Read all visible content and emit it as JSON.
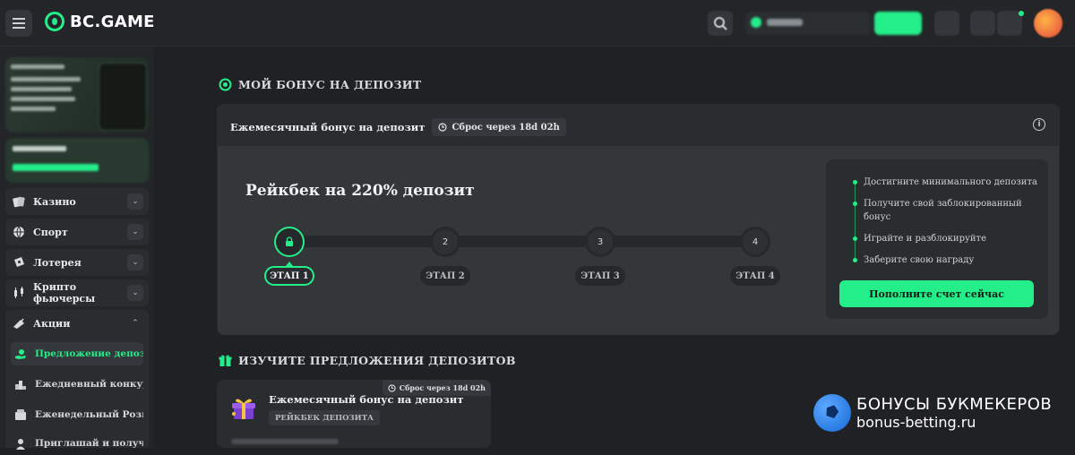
{
  "header": {
    "logo_text": "BC.GAME",
    "accent": "#24ee89"
  },
  "sidebar": {
    "items": [
      {
        "label": "Казино",
        "icon": "cards-icon"
      },
      {
        "label": "Спорт",
        "icon": "ball-icon"
      },
      {
        "label": "Лотерея",
        "icon": "ticket-icon"
      },
      {
        "label": "Крипто фьючерсы",
        "icon": "candles-icon"
      },
      {
        "label": "Акции",
        "icon": "promo-icon"
      }
    ],
    "sub_items": [
      {
        "label": "Предложение депозита",
        "icon": "hand-coin-icon"
      },
      {
        "label": "Ежедневный конкурс",
        "icon": "podium-icon"
      },
      {
        "label": "Еженедельный Розыгры",
        "icon": "lottery-icon"
      },
      {
        "label": "Приглашай и получай",
        "icon": "invite-icon"
      }
    ]
  },
  "main": {
    "bonus_section_title": "МОЙ БОНУС НА ДЕПОЗИТ",
    "bonus_card": {
      "title": "Ежемесячный бонус на депозит",
      "reset": "Сброс через 18d 02h",
      "rakeback_prefix": "Рейкбек на ",
      "rakeback_percent": "220%",
      "rakeback_suffix": " депозит",
      "steps": [
        {
          "number": "",
          "label": "ЭТАП 1",
          "state": "current"
        },
        {
          "number": "2",
          "label": "ЭТАП 2",
          "state": "pending"
        },
        {
          "number": "3",
          "label": "ЭТАП 3",
          "state": "pending"
        },
        {
          "number": "4",
          "label": "ЭТАП 4",
          "state": "pending"
        }
      ],
      "checklist": [
        "Достигните минимального депозита",
        "Получите свой заблокированный бонус",
        "Играйте и разблокируйте",
        "Заберите свою награду"
      ],
      "cta": "Пополните счет сейчас"
    },
    "explore_section_title": "ИЗУЧИТЕ ПРЕДЛОЖЕНИЯ ДЕПОЗИТОВ",
    "offer_card": {
      "title": "Ежемесячный бонус на депозит",
      "tag": "РЕЙКБЕК ДЕПОЗИТА",
      "reset": "Сброс через 18d 02h"
    }
  },
  "watermark": {
    "line1": "БОНУСЫ БУКМЕКЕРОВ",
    "line2": "bonus-betting.ru"
  }
}
